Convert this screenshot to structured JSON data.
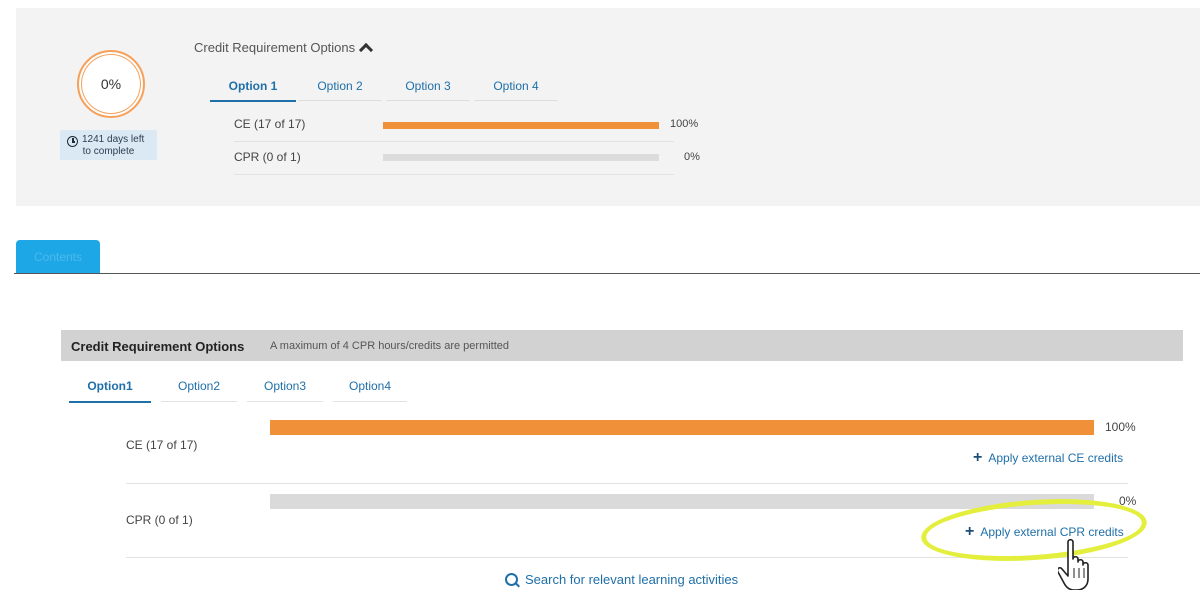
{
  "summary": {
    "progress_percent": "0%",
    "days_left_line1": "1241 days left",
    "days_left_line2": "to complete",
    "heading": "Credit Requirement Options",
    "tabs": [
      "Option 1",
      "Option 2",
      "Option 3",
      "Option 4"
    ],
    "active_tab": 0,
    "rows": [
      {
        "label": "CE (17 of 17)",
        "percent": "100%",
        "fill": 1.0
      },
      {
        "label": "CPR (0 of 1)",
        "percent": "0%",
        "fill": 0.0
      }
    ]
  },
  "contents_tab": {
    "label": "Contents"
  },
  "panel": {
    "title": "Credit Requirement Options",
    "note": "A maximum of 4 CPR hours/credits are permitted",
    "tabs": [
      "Option1",
      "Option2",
      "Option3",
      "Option4"
    ],
    "active_tab": 0,
    "rows": [
      {
        "label": "CE (17 of 17)",
        "percent": "100%",
        "fill": 1.0,
        "apply_label": "Apply external CE credits"
      },
      {
        "label": "CPR (0 of 1)",
        "percent": "0%",
        "fill": 0.0,
        "apply_label": "Apply external CPR credits"
      }
    ],
    "search_label": "Search for relevant learning activities"
  },
  "colors": {
    "accent_blue": "#1f6fa8",
    "progress_orange": "#f0913a",
    "tab_blue": "#1da7e6",
    "highlight_yellow": "#e3ef3c"
  }
}
